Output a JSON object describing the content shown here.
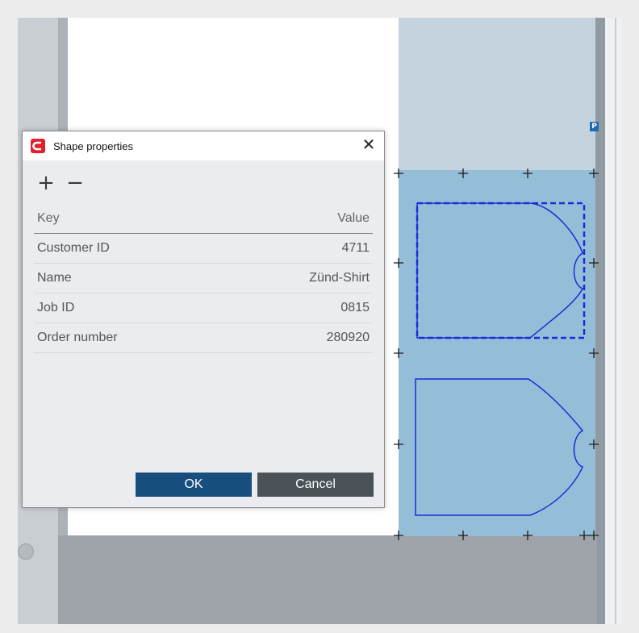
{
  "dialog": {
    "title": "Shape properties",
    "add_symbol": "+",
    "remove_symbol": "−",
    "close_symbol": "✕",
    "columns": {
      "key": "Key",
      "value": "Value"
    },
    "rows": [
      {
        "key": "Customer ID",
        "value": "4711"
      },
      {
        "key": "Name",
        "value": "Zünd-Shirt"
      },
      {
        "key": "Job ID",
        "value": "0815"
      },
      {
        "key": "Order number",
        "value": "280920"
      }
    ],
    "ok_label": "OK",
    "cancel_label": "Cancel"
  },
  "canvas": {
    "marker_label": "P"
  },
  "colors": {
    "dialog_bg": "#eaecef",
    "ok_button": "#174e7e",
    "cancel_button": "#4b5257",
    "shape_outline": "#1a2dd6",
    "material_fill": "#94bdd8",
    "app_icon_red": "#e0202c"
  }
}
